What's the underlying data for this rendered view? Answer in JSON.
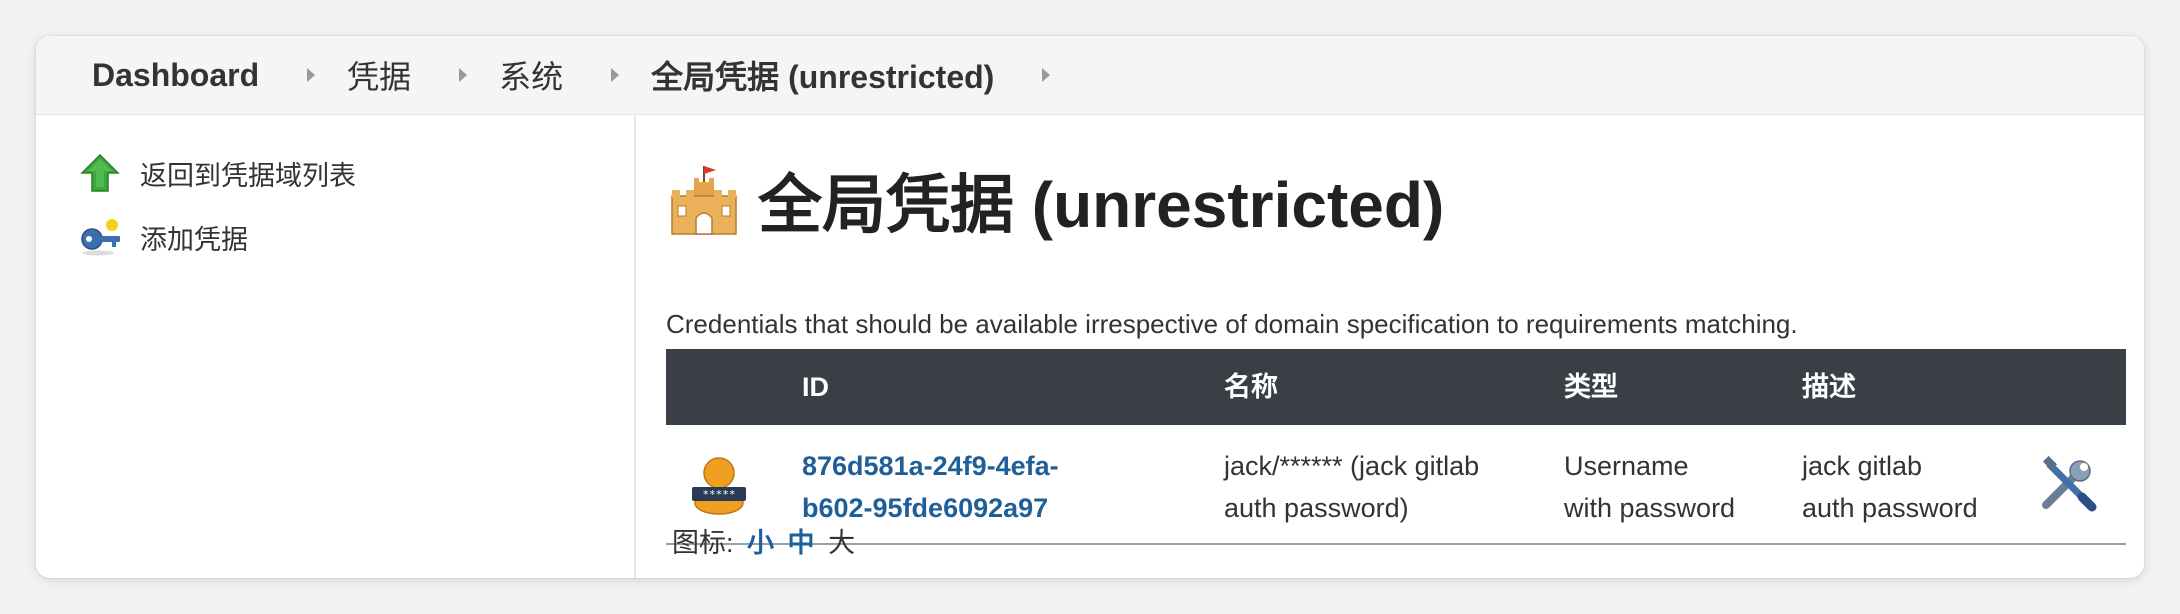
{
  "breadcrumb": [
    {
      "label": "Dashboard"
    },
    {
      "label": "凭据"
    },
    {
      "label": "系统"
    },
    {
      "label": "全局凭据 (unrestricted)"
    }
  ],
  "sidebar": {
    "items": [
      {
        "label": "返回到凭据域列表",
        "icon": "green-up-arrow-icon"
      },
      {
        "label": "添加凭据",
        "icon": "key-icon"
      }
    ]
  },
  "main": {
    "title": "全局凭据 (unrestricted)",
    "title_icon": "castle-icon",
    "description": "Credentials that should be available irrespective of domain specification to requirements matching.",
    "table": {
      "headers": [
        "ID",
        "名称",
        "类型",
        "描述"
      ],
      "rows": [
        {
          "icon": "user-password-icon",
          "id_line1": "876d581a-24f9-4efa-",
          "id_line2": "b602-95fde6092a97",
          "name_line1": "jack/****** (jack gitlab",
          "name_line2": "auth password)",
          "type_line1": "Username",
          "type_line2": "with password",
          "desc_line1": "jack gitlab",
          "desc_line2": "auth password",
          "action_icon": "configure-tools-icon"
        }
      ]
    },
    "icon_size": {
      "label": "图标:",
      "small": "小",
      "medium": "中",
      "large": "大"
    }
  },
  "colors": {
    "table_header_bg": "#3a3f46",
    "link": "#1e5f99",
    "row_border": "#8aa4b8"
  }
}
